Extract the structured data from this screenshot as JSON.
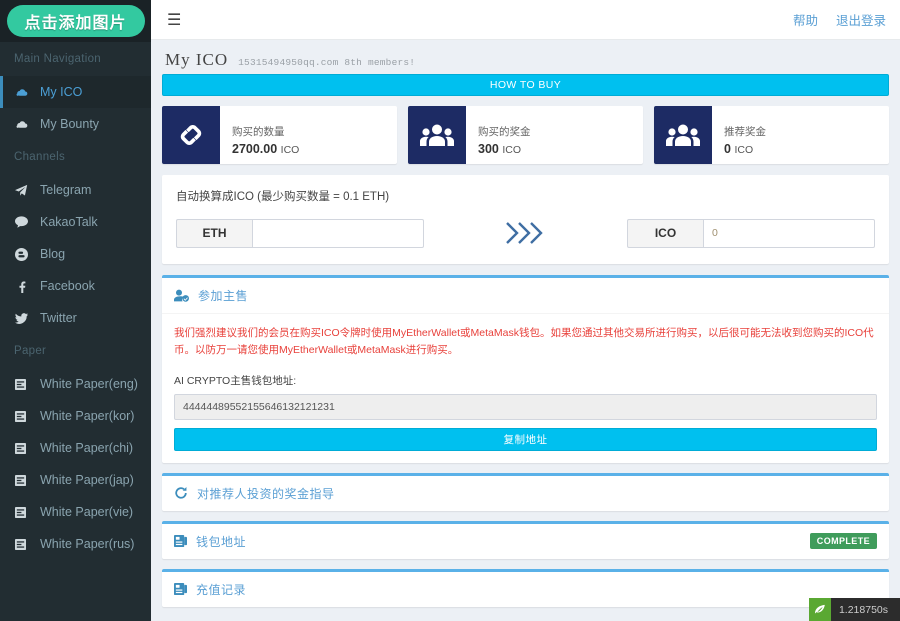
{
  "sidebar": {
    "logo_label": "点击添加图片",
    "sections": [
      {
        "header": "Main Navigation",
        "items": [
          {
            "label": "My ICO",
            "icon": "cloud-icon",
            "active": true
          },
          {
            "label": "My Bounty",
            "icon": "cloud-icon",
            "active": false
          }
        ]
      },
      {
        "header": "Channels",
        "items": [
          {
            "label": "Telegram",
            "icon": "paper-plane-icon",
            "active": false
          },
          {
            "label": "KakaoTalk",
            "icon": "comment-icon",
            "active": false
          },
          {
            "label": "Blog",
            "icon": "blogger-icon",
            "active": false
          },
          {
            "label": "Facebook",
            "icon": "facebook-icon",
            "active": false
          },
          {
            "label": "Twitter",
            "icon": "twitter-icon",
            "active": false
          }
        ]
      },
      {
        "header": "Paper",
        "items": [
          {
            "label": "White Paper(eng)",
            "icon": "document-icon",
            "active": false
          },
          {
            "label": "White Paper(kor)",
            "icon": "document-icon",
            "active": false
          },
          {
            "label": "White Paper(chi)",
            "icon": "document-icon",
            "active": false
          },
          {
            "label": "White Paper(jap)",
            "icon": "document-icon",
            "active": false
          },
          {
            "label": "White Paper(vie)",
            "icon": "document-icon",
            "active": false
          },
          {
            "label": "White Paper(rus)",
            "icon": "document-icon",
            "active": false
          }
        ]
      }
    ]
  },
  "topbar": {
    "menu_icon": "hamburger-icon",
    "help_label": "帮助",
    "logout_label": "退出登录"
  },
  "page": {
    "title": "My ICO",
    "subtitle": "15315494950qq.com 8th members!"
  },
  "how_to_buy": {
    "label": "HOW TO BUY"
  },
  "stats": [
    {
      "label": "购买的数量",
      "value": "2700.00",
      "unit": "ICO",
      "icon": "chain-link-icon"
    },
    {
      "label": "购买的奖金",
      "value": "300",
      "unit": "ICO",
      "icon": "users-icon"
    },
    {
      "label": "推荐奖金",
      "value": "0",
      "unit": "ICO",
      "icon": "users-icon"
    }
  ],
  "convert": {
    "title": "自动换算成ICO (最少购买数量 = 0.1 ETH)",
    "eth_addon": "ETH",
    "eth_value": "",
    "eth_placeholder": "",
    "arrow_icon": "double-chevron-right-icon",
    "ico_addon": "ICO",
    "ico_value": "0"
  },
  "main_sale": {
    "icon": "user-check-icon",
    "title": "参加主售",
    "warning": "我们强烈建议我们的会员在购买ICO令牌时使用MyEtherWallet或MetaMask钱包。如果您通过其他交易所进行购买，以后很可能无法收到您购买的ICO代币。以防万一请您使用MyEtherWallet或MetaMask进行购买。",
    "address_label": "AI CRYPTO主售钱包地址:",
    "address_value": "44444489552155646132121231",
    "copy_button": "复制地址"
  },
  "sections": [
    {
      "icon": "refresh-icon",
      "title": "对推荐人投资的奖金指导",
      "badge": ""
    },
    {
      "icon": "wallet-icon",
      "title": "钱包地址",
      "badge": "COMPLETE"
    },
    {
      "icon": "wallet-icon",
      "title": "充值记录",
      "badge": ""
    }
  ],
  "debugbar": {
    "icon": "debug-leaf-icon",
    "time": "1.218750s"
  },
  "colors": {
    "accent": "#00c0ef",
    "sidebar_bg": "#222d32",
    "stat_icon_bg": "#1d2b64",
    "logo_bg": "#33c9a0",
    "warning": "#e8413b",
    "complete_badge": "#3f9c5b",
    "box_top_border": "#5ab1e8"
  }
}
